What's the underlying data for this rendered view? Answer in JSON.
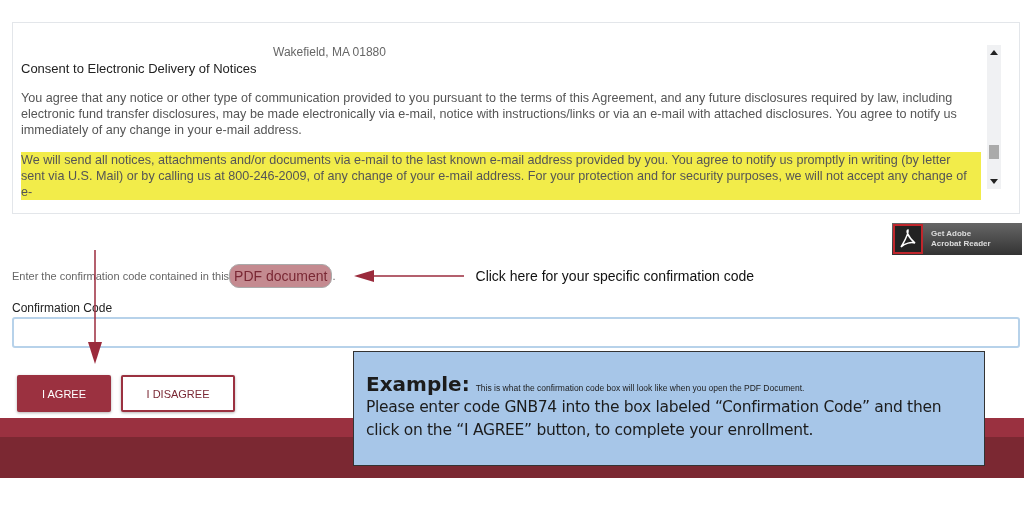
{
  "agreement": {
    "address": "Wakefield, MA 01880",
    "heading": "Consent to Electronic Delivery of Notices",
    "paragraphs": [
      {
        "text": "You agree that any notice or other type of communication provided to you pursuant to the terms of this Agreement, and any future disclosures required by law, including electronic fund transfer disclosures, may be made electronically via e-mail, notice with instructions/links or via an e-mail with attached disclosures. You agree to notify us immediately of any change in your e-mail address.",
        "highlighted": false
      },
      {
        "text": "We will send all notices, attachments and/or documents via e-mail to the last known e-mail address provided by you. You agree to notify us promptly in writing (by letter sent via U.S. Mail) or by calling us at 800-246-2009, of any change of your e-mail address. For your protection and for security purposes, we will not accept any change of e-",
        "highlighted": true
      }
    ]
  },
  "acrobat_badge": {
    "line_1": "Get Adobe",
    "line_2": "Acrobat Reader"
  },
  "instruction": {
    "text": "Enter the confirmation code contained in this",
    "link": "PDF document",
    "suffix": "."
  },
  "annotation": "Click here for your specific confirmation code",
  "field": {
    "label": "Confirmation Code"
  },
  "buttons": [
    {
      "label": "I AGREE",
      "kind": "primary"
    },
    {
      "label": "I DISAGREE",
      "kind": "secondary"
    }
  ],
  "callout": {
    "title": "Example:",
    "note": "This is what the confirmation code box will look like when you open the PDF Document.",
    "body": "Please enter code GNB74 into the box labeled “Confirmation Code” and then click on the “I AGREE”  button, to complete your enrollment."
  }
}
